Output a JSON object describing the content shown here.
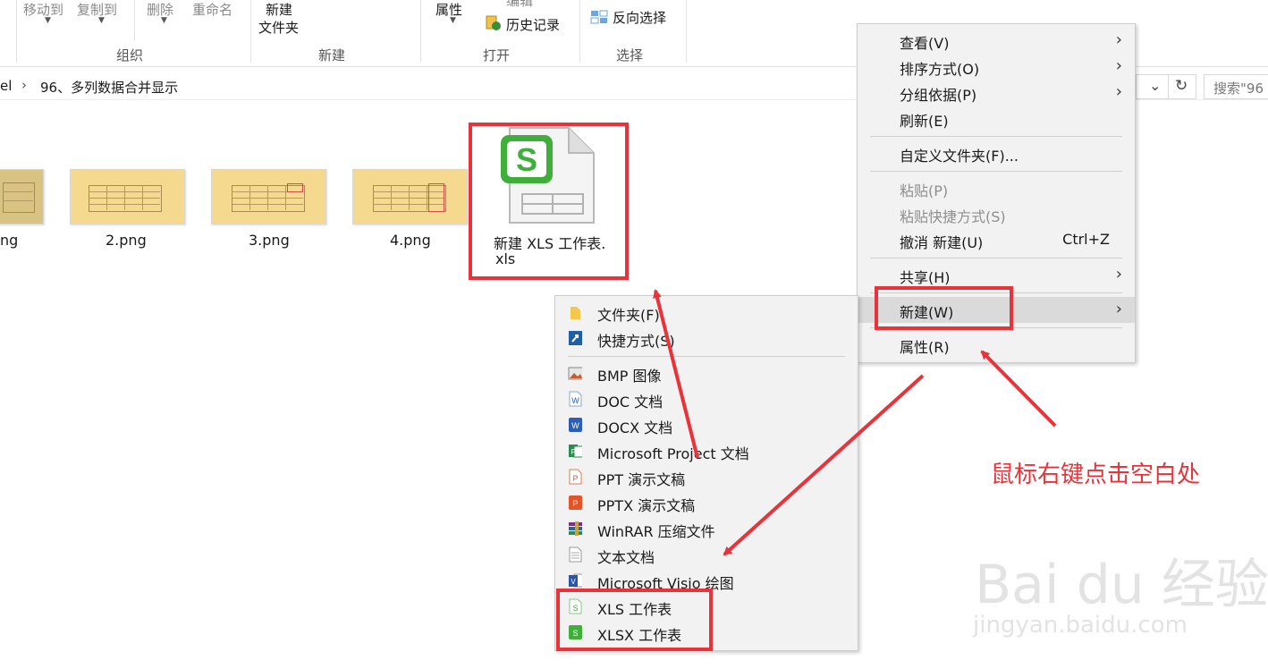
{
  "ribbon": {
    "move_to": "移动到",
    "copy_to": "复制到",
    "delete": "删除",
    "rename": "重命名",
    "organize": "组织",
    "new_folder_1": "新建",
    "new_folder_2": "文件夹",
    "new_group": "新建",
    "properties": "属性",
    "edit_partial": "编辑",
    "history": "历史记录",
    "open_group": "打开",
    "invert_select": "反向选择",
    "select_group": "选择"
  },
  "address": {
    "crumb_prev": "el",
    "crumb_current": "96、多列数据合并显示",
    "search_placeholder": "搜索\"96"
  },
  "files": [
    {
      "name": "ng"
    },
    {
      "name": "2.png"
    },
    {
      "name": "3.png"
    },
    {
      "name": "4.png"
    },
    {
      "name_line1": "新建 XLS 工作表.",
      "name_line2": "xls",
      "icon_letter": "S"
    }
  ],
  "main_menu": {
    "items": [
      {
        "label": "查看(V)",
        "arrow": "›"
      },
      {
        "label": "排序方式(O)",
        "arrow": "›"
      },
      {
        "label": "分组依据(P)",
        "arrow": "›"
      },
      {
        "label": "刷新(E)"
      },
      {
        "label": "自定义文件夹(F)..."
      },
      {
        "label": "粘贴(P)"
      },
      {
        "label": "粘贴快捷方式(S)"
      },
      {
        "label": "撤消 新建(U)",
        "accel": "Ctrl+Z"
      },
      {
        "label": "共享(H)",
        "arrow": "›"
      },
      {
        "label": "新建(W)",
        "arrow": "›"
      },
      {
        "label": "属性(R)"
      }
    ]
  },
  "new_menu": {
    "items": [
      {
        "label": "文件夹(F)"
      },
      {
        "label": "快捷方式(S)"
      },
      {
        "label": "BMP 图像"
      },
      {
        "label": "DOC 文档"
      },
      {
        "label": "DOCX 文档"
      },
      {
        "label": "Microsoft Project 文档"
      },
      {
        "label": "PPT 演示文稿"
      },
      {
        "label": "PPTX 演示文稿"
      },
      {
        "label": "WinRAR 压缩文件"
      },
      {
        "label": "文本文档"
      },
      {
        "label": "Microsoft Visio 绘图"
      },
      {
        "label": "XLS 工作表"
      },
      {
        "label": "XLSX 工作表"
      }
    ]
  },
  "annotation": {
    "text": "鼠标右键点击空白处"
  },
  "watermark": {
    "brand": "Bai du 经验",
    "url": "jingyan.baidu.com"
  },
  "colors": {
    "accent_red": "#e8333a",
    "wps_green": "#3fae3a"
  }
}
